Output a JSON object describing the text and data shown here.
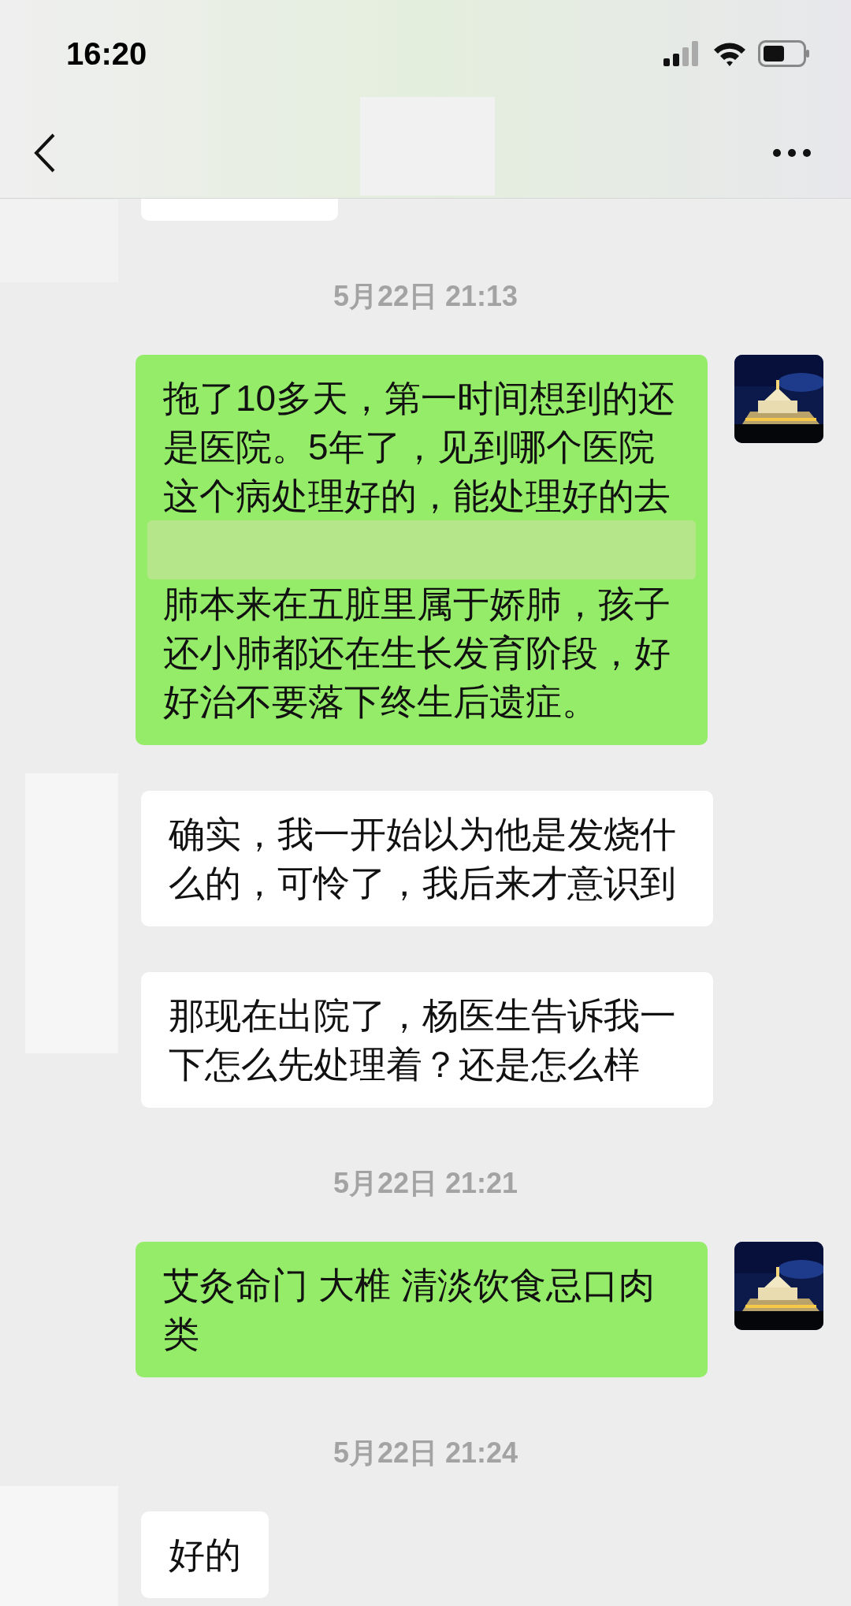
{
  "status_bar": {
    "time": "16:20"
  },
  "messages": [
    {
      "kind": "partial"
    },
    {
      "kind": "timestamp",
      "text": "5月22日 21:13"
    },
    {
      "kind": "outgoing",
      "blocks": [
        {
          "kind": "text",
          "text": "拖了10多天，第一时间想到的还是医院。5年了，见到哪个医院这个病处理好的，能处理好的去"
        },
        {
          "kind": "redaction"
        },
        {
          "kind": "text",
          "text": "肺本来在五脏里属于娇肺，孩子还小肺都还在生长发育阶段，好好治不要落下终生后遗症。"
        }
      ]
    },
    {
      "kind": "incoming",
      "blocks": [
        {
          "kind": "text",
          "text": "确实，我一开始以为他是发烧什么的，可怜了，我后来才意识到"
        }
      ]
    },
    {
      "kind": "incoming",
      "blocks": [
        {
          "kind": "text",
          "text": "那现在出院了，杨医生告诉我一下怎么先处理着？还是怎么样"
        }
      ]
    },
    {
      "kind": "timestamp",
      "text": "5月22日 21:21"
    },
    {
      "kind": "outgoing",
      "blocks": [
        {
          "kind": "text",
          "text": "艾灸命门 大椎 清淡饮食忌口肉类"
        }
      ]
    },
    {
      "kind": "timestamp",
      "text": "5月22日 21:24"
    },
    {
      "kind": "incoming",
      "blocks": [
        {
          "kind": "text",
          "text": "好的"
        }
      ]
    }
  ]
}
